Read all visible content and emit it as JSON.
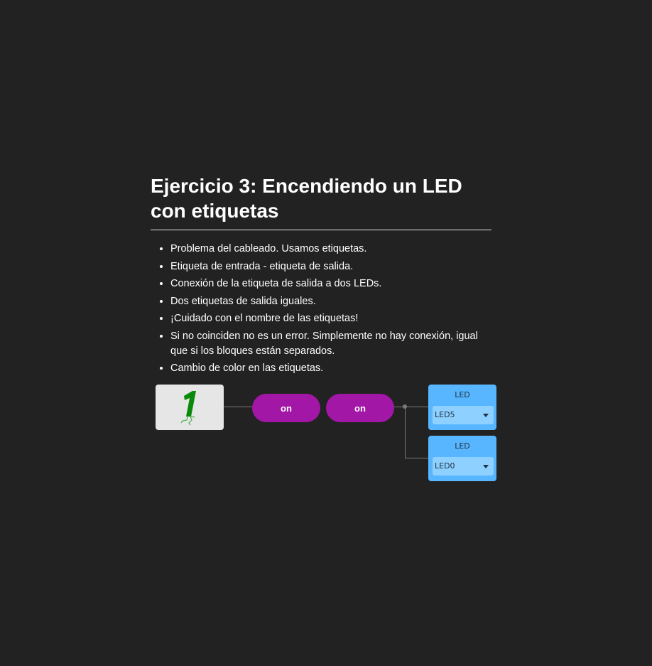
{
  "exercise": {
    "title": "Ejercicio 3: Encendiendo un LED con etiquetas",
    "bullets": [
      "Problema del cableado. Usamos etiquetas.",
      "Etiqueta de entrada - etiqueta de salida.",
      "Conexión de la etiqueta de salida a dos LEDs.",
      "Dos etiquetas de salida iguales.",
      "¡Cuidado con el nombre de las etiquetas!",
      "Si no coinciden no es un error. Simplemente no hay conexión, igual que si los bloques están separados.",
      "Cambio de color en las etiquetas."
    ]
  },
  "diagram": {
    "constant": {
      "value": "1",
      "icon": "digit-one-walking-icon",
      "color": "#0a8a0a"
    },
    "input_tag": {
      "label": "on"
    },
    "output_tag": {
      "label": "on"
    },
    "leds": [
      {
        "title": "LED",
        "selected": "LED5"
      },
      {
        "title": "LED",
        "selected": "LED0"
      }
    ],
    "colors": {
      "tag": "#a217a6",
      "led_block": "#57b6ff",
      "led_select": "#8ed0ff",
      "constant_block": "#e6e6e6",
      "wire": "#7a7a7a",
      "background": "#222222"
    }
  }
}
